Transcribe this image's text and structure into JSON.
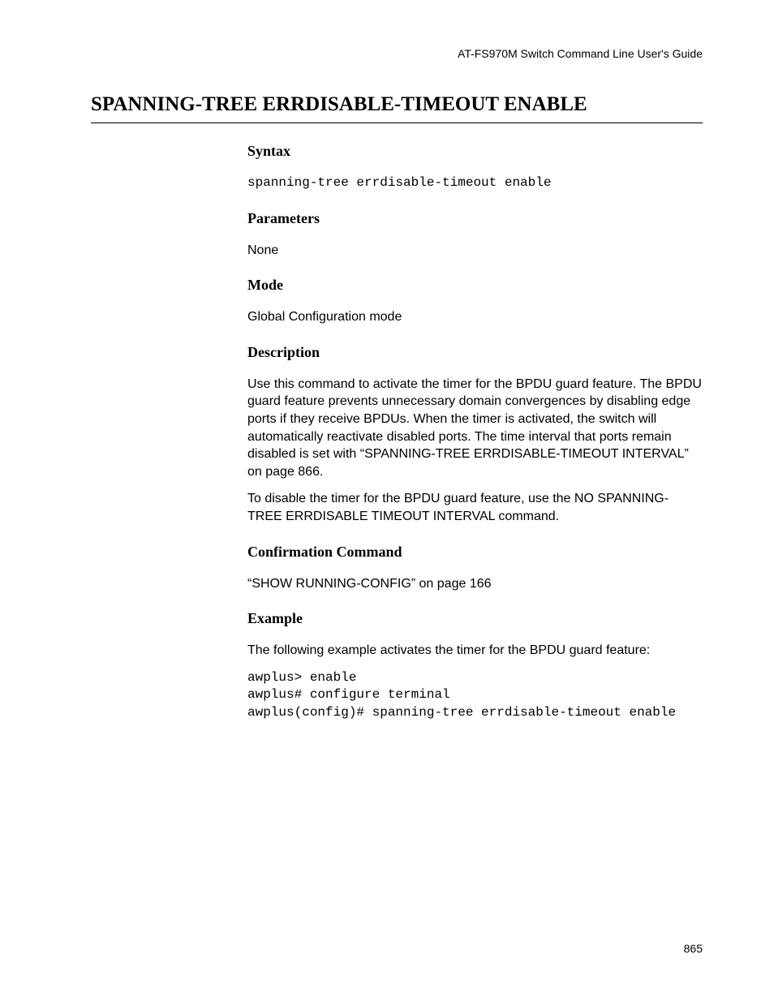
{
  "header": {
    "guide_title": "AT-FS970M Switch Command Line User's Guide"
  },
  "title": "SPANNING-TREE ERRDISABLE-TIMEOUT ENABLE",
  "sections": {
    "syntax": {
      "heading": "Syntax",
      "command": "spanning-tree errdisable-timeout enable"
    },
    "parameters": {
      "heading": "Parameters",
      "text": "None"
    },
    "mode": {
      "heading": "Mode",
      "text": "Global Configuration mode"
    },
    "description": {
      "heading": "Description",
      "para1": "Use this command to activate the timer for the BPDU guard feature. The BPDU guard feature prevents unnecessary domain convergences by disabling edge ports if they receive BPDUs. When the timer is activated, the switch will automatically reactivate disabled ports. The time interval that ports remain disabled is set with “SPANNING-TREE ERRDISABLE-TIMEOUT INTERVAL” on page 866.",
      "para2": "To disable the timer for the BPDU guard feature, use the NO SPANNING-TREE ERRDISABLE TIMEOUT INTERVAL command."
    },
    "confirmation": {
      "heading": "Confirmation Command",
      "text": "“SHOW RUNNING-CONFIG” on page 166"
    },
    "example": {
      "heading": "Example",
      "intro": "The following example activates the timer for the BPDU guard feature:",
      "code": "awplus> enable\nawplus# configure terminal\nawplus(config)# spanning-tree errdisable-timeout enable"
    }
  },
  "page_number": "865"
}
